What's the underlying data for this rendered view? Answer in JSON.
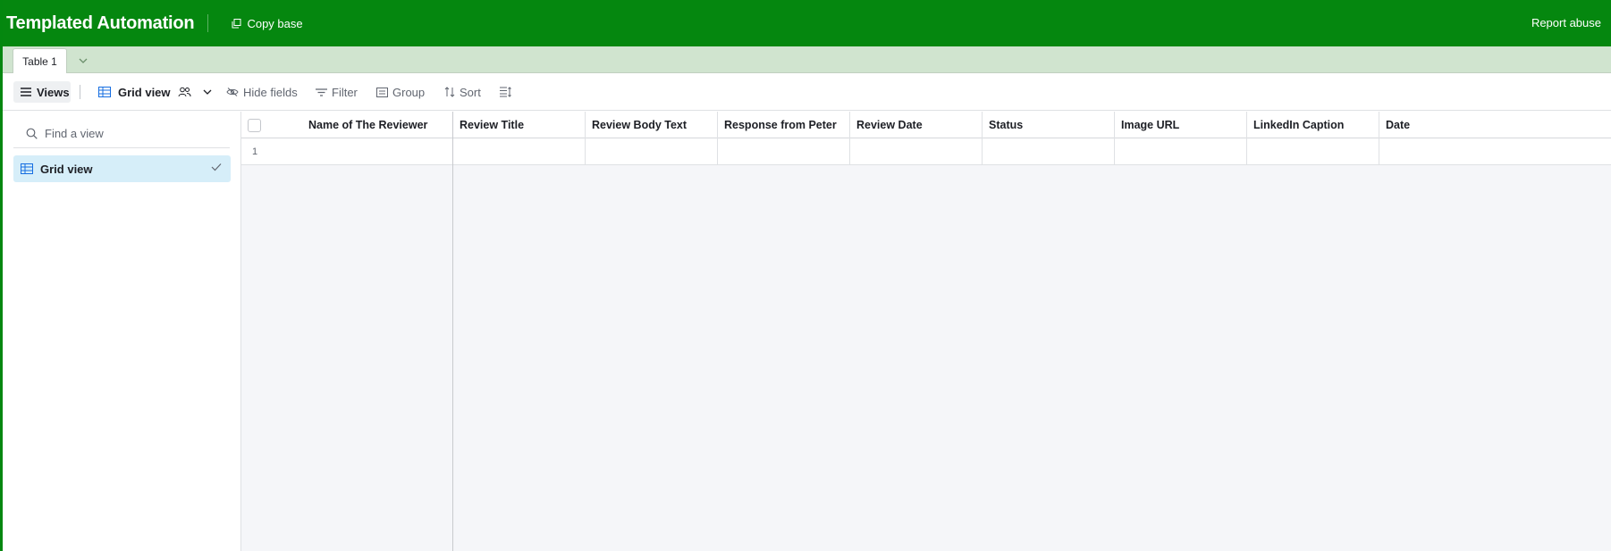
{
  "header": {
    "title": "Templated Automation",
    "copy_base": "Copy base",
    "report_abuse": "Report abuse"
  },
  "tabs": [
    {
      "label": "Table 1",
      "active": true
    }
  ],
  "toolbar": {
    "views": "Views",
    "grid_view": "Grid view",
    "hide_fields": "Hide fields",
    "filter": "Filter",
    "group": "Group",
    "sort": "Sort"
  },
  "sidebar": {
    "search_placeholder": "Find a view",
    "views": [
      {
        "label": "Grid view",
        "selected": true
      }
    ]
  },
  "grid": {
    "columns": [
      "Name of The Reviewer",
      "Review Title",
      "Review Body Text",
      "Response from Peter",
      "Review Date",
      "Status",
      "Image URL",
      "LinkedIn Caption",
      "Date"
    ],
    "rows": [
      {
        "number": "1",
        "cells": [
          "",
          "",
          "",
          "",
          "",
          "",
          "",
          "",
          ""
        ]
      }
    ]
  },
  "colors": {
    "header_bg": "#05870f",
    "tabbar_bg": "#d0e4cf",
    "selected_view_bg": "#d6eef9",
    "grid_bg": "#f5f6f9"
  }
}
